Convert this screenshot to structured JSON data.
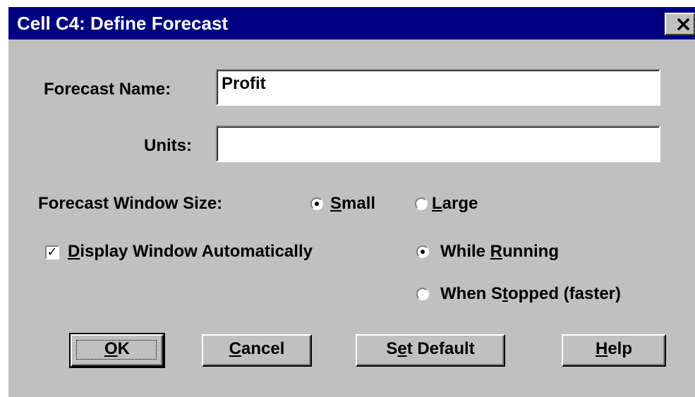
{
  "window": {
    "title": "Cell C4: Define Forecast",
    "close_glyph": "×",
    "close_icon": "close-icon"
  },
  "forecast_name": {
    "label": "Forecast Name:",
    "value": "Profit"
  },
  "units": {
    "label": "Units:",
    "value": ""
  },
  "window_size": {
    "label": "Forecast Window Size:",
    "options": [
      {
        "pre": "",
        "key": "S",
        "post": "mall",
        "selected": true
      },
      {
        "pre": "",
        "key": "L",
        "post": "arge",
        "selected": false
      }
    ]
  },
  "display": {
    "pre": "",
    "key": "D",
    "post": "isplay Window Automatically",
    "checked": true,
    "check_glyph": "✓",
    "options": [
      {
        "pre": "While ",
        "key": "R",
        "post": "unning",
        "selected": true
      },
      {
        "pre": "When S",
        "key": "t",
        "post": "opped (faster)",
        "selected": false
      }
    ]
  },
  "buttons": {
    "ok": {
      "pre": "",
      "key": "O",
      "post": "K"
    },
    "cancel": {
      "pre": "",
      "key": "C",
      "post": "ancel"
    },
    "set_default": {
      "pre": "S",
      "key": "e",
      "post": "t Default"
    },
    "help": {
      "pre": "",
      "key": "H",
      "post": "elp"
    }
  },
  "colors": {
    "titlebar": "#000080",
    "face": "#c0c0c0"
  }
}
